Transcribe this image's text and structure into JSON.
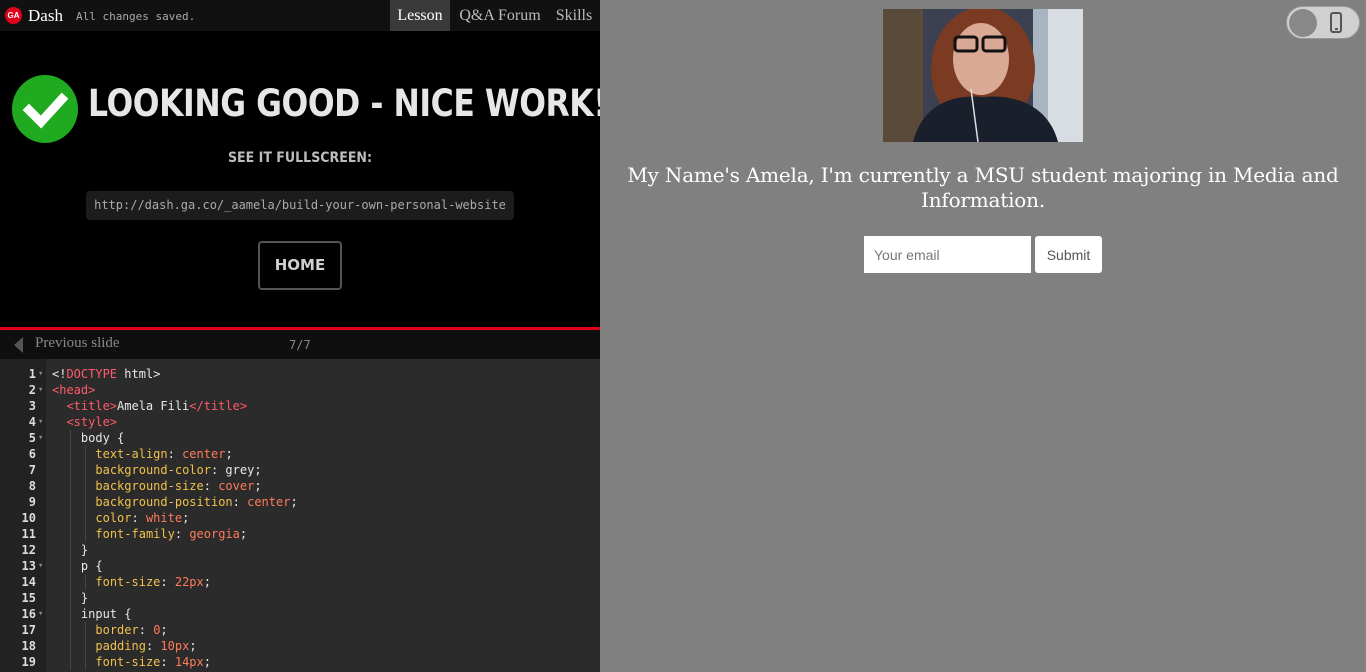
{
  "topbar": {
    "logo": "GA",
    "brand": "Dash",
    "status": "All changes saved.",
    "tabs": [
      "Lesson",
      "Q&A Forum",
      "Skills"
    ],
    "active_tab": "Lesson"
  },
  "success": {
    "headline": "LOOKING GOOD - NICE WORK!",
    "see_fullscreen": "SEE IT FULLSCREEN:",
    "url": "http://dash.ga.co/_aamela/build-your-own-personal-website",
    "home_button": "HOME"
  },
  "slide_nav": {
    "previous_label": "Previous slide",
    "counter": "7/7"
  },
  "code": [
    {
      "n": "1",
      "fold": true,
      "indent": 0,
      "tokens": [
        [
          "plain",
          "<!"
        ],
        [
          "tag",
          "DOCTYPE"
        ],
        [
          "plain",
          " html>"
        ]
      ]
    },
    {
      "n": "2",
      "fold": true,
      "indent": 0,
      "tokens": [
        [
          "tag",
          "<head>"
        ]
      ]
    },
    {
      "n": "3",
      "fold": false,
      "indent": 1,
      "tokens": [
        [
          "tag",
          "<title>"
        ],
        [
          "plain",
          "Amela Fili"
        ],
        [
          "tag",
          "</title>"
        ]
      ]
    },
    {
      "n": "4",
      "fold": true,
      "indent": 1,
      "tokens": [
        [
          "tag",
          "<style>"
        ]
      ]
    },
    {
      "n": "5",
      "fold": true,
      "indent": 2,
      "tokens": [
        [
          "plain",
          "body {"
        ]
      ]
    },
    {
      "n": "6",
      "fold": false,
      "indent": 3,
      "tokens": [
        [
          "prop",
          "text-align"
        ],
        [
          "plain",
          ": "
        ],
        [
          "val",
          "center"
        ],
        [
          "plain",
          ";"
        ]
      ]
    },
    {
      "n": "7",
      "fold": false,
      "indent": 3,
      "tokens": [
        [
          "prop",
          "background-color"
        ],
        [
          "plain",
          ": grey;"
        ]
      ]
    },
    {
      "n": "8",
      "fold": false,
      "indent": 3,
      "tokens": [
        [
          "prop",
          "background-size"
        ],
        [
          "plain",
          ": "
        ],
        [
          "val",
          "cover"
        ],
        [
          "plain",
          ";"
        ]
      ]
    },
    {
      "n": "9",
      "fold": false,
      "indent": 3,
      "tokens": [
        [
          "prop",
          "background-position"
        ],
        [
          "plain",
          ": "
        ],
        [
          "val",
          "center"
        ],
        [
          "plain",
          ";"
        ]
      ]
    },
    {
      "n": "10",
      "fold": false,
      "indent": 3,
      "tokens": [
        [
          "prop",
          "color"
        ],
        [
          "plain",
          ": "
        ],
        [
          "val",
          "white"
        ],
        [
          "plain",
          ";"
        ]
      ]
    },
    {
      "n": "11",
      "fold": false,
      "indent": 3,
      "tokens": [
        [
          "prop",
          "font-family"
        ],
        [
          "plain",
          ": "
        ],
        [
          "val",
          "georgia"
        ],
        [
          "plain",
          ";"
        ]
      ]
    },
    {
      "n": "12",
      "fold": false,
      "indent": 2,
      "tokens": [
        [
          "plain",
          "}"
        ]
      ]
    },
    {
      "n": "13",
      "fold": true,
      "indent": 2,
      "tokens": [
        [
          "plain",
          "p {"
        ]
      ]
    },
    {
      "n": "14",
      "fold": false,
      "indent": 3,
      "tokens": [
        [
          "prop",
          "font-size"
        ],
        [
          "plain",
          ": "
        ],
        [
          "val",
          "22px"
        ],
        [
          "plain",
          ";"
        ]
      ]
    },
    {
      "n": "15",
      "fold": false,
      "indent": 2,
      "tokens": [
        [
          "plain",
          "}"
        ]
      ]
    },
    {
      "n": "16",
      "fold": true,
      "indent": 2,
      "tokens": [
        [
          "plain",
          "input {"
        ]
      ]
    },
    {
      "n": "17",
      "fold": false,
      "indent": 3,
      "tokens": [
        [
          "prop",
          "border"
        ],
        [
          "plain",
          ": "
        ],
        [
          "val",
          "0"
        ],
        [
          "plain",
          ";"
        ]
      ]
    },
    {
      "n": "18",
      "fold": false,
      "indent": 3,
      "tokens": [
        [
          "prop",
          "padding"
        ],
        [
          "plain",
          ": "
        ],
        [
          "val",
          "10px"
        ],
        [
          "plain",
          ";"
        ]
      ]
    },
    {
      "n": "19",
      "fold": false,
      "indent": 3,
      "tokens": [
        [
          "prop",
          "font-size"
        ],
        [
          "plain",
          ": "
        ],
        [
          "val",
          "14px"
        ],
        [
          "plain",
          ";"
        ]
      ]
    }
  ],
  "preview": {
    "intro": "My Name's Amela, I'm currently a MSU student majoring in Media and Information.",
    "email_placeholder": "Your email",
    "submit_label": "Submit",
    "photo_alt": "profile-photo"
  },
  "colors": {
    "accent_red": "#e0001b",
    "success_green": "#1faa1f",
    "preview_bg": "#808080"
  }
}
